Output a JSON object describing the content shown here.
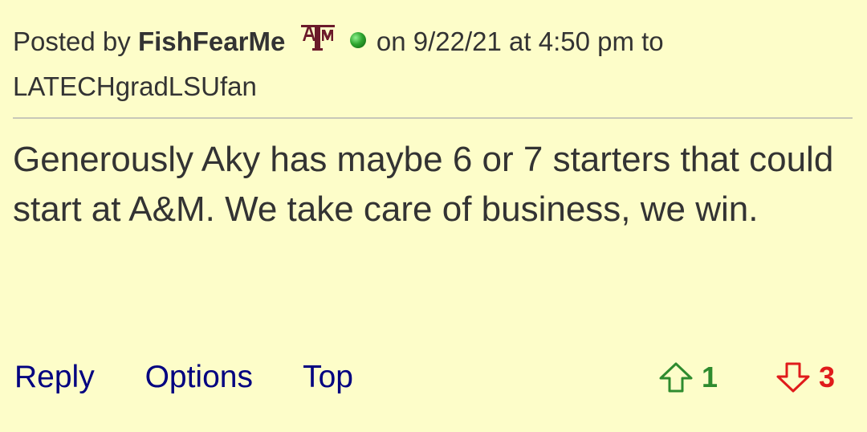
{
  "post": {
    "posted_by_label": "Posted by",
    "author": "FishFearMe",
    "team_logo_text": "ATM",
    "on_label": "on",
    "date": "9/22/21",
    "at_label": "at",
    "time": "4:50 pm",
    "to_label": "to",
    "recipient": "LATECHgradLSUfan",
    "body": "Generously Aky has maybe 6 or 7 starters that could start at A&M. We take care of business, we win."
  },
  "actions": {
    "reply_label": "Reply",
    "options_label": "Options",
    "top_label": "Top"
  },
  "votes": {
    "up_count": "1",
    "down_count": "3",
    "up_color": "#2e8b2e",
    "down_color": "#e01b1b"
  },
  "colors": {
    "background": "#fdfdc9",
    "link": "#000080",
    "text": "#333333",
    "online_indicator": "#2fa52f",
    "logo": "#6b1a2a"
  },
  "icons": {
    "team_logo": "texas-am-logo-icon",
    "online_status": "online-dot-icon",
    "upvote": "arrow-up-icon",
    "downvote": "arrow-down-icon"
  }
}
